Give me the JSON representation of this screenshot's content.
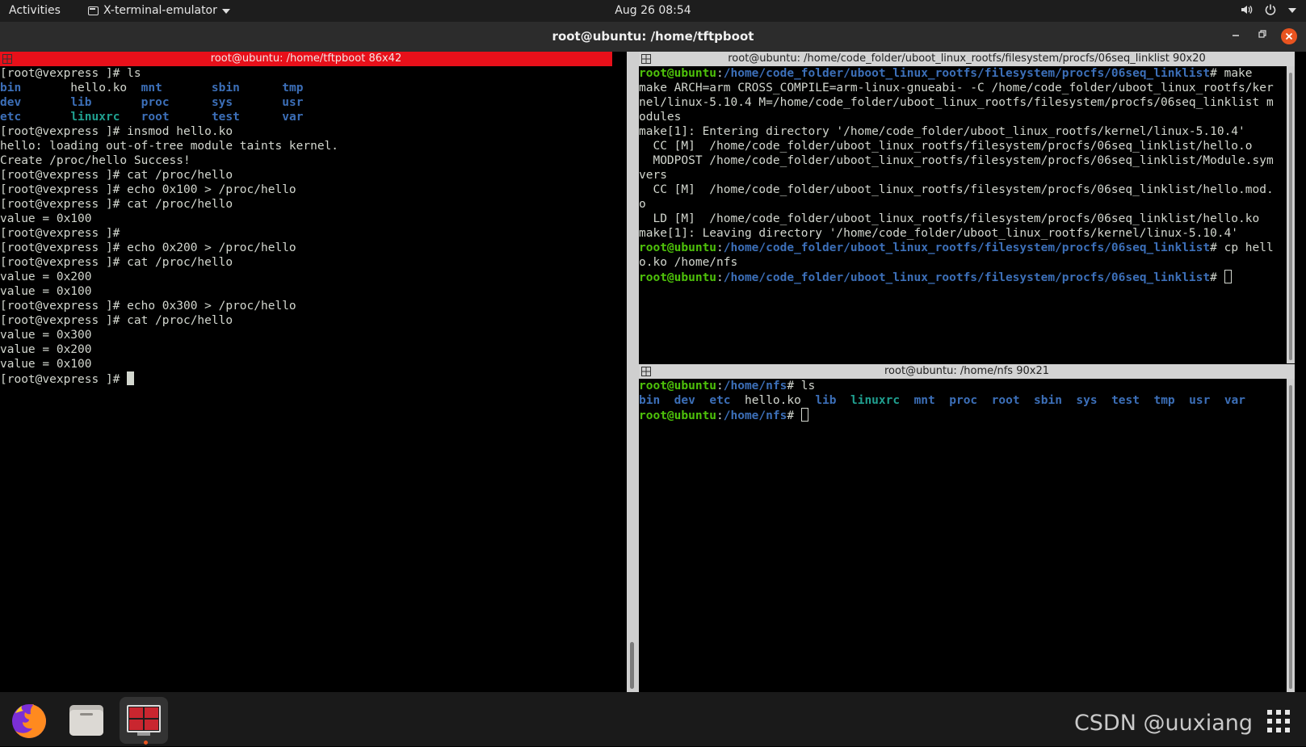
{
  "topbar": {
    "activities": "Activities",
    "app_name": "X-terminal-emulator",
    "clock": "Aug 26  08:54"
  },
  "window": {
    "title": "root@ubuntu: /home/tftpboot",
    "colors": {
      "close_button": "#e95420",
      "active_pane_title": "#e8101a"
    }
  },
  "panes": {
    "left": {
      "title": "root@ubuntu: /home/tftpboot 86x42",
      "lines": [
        [
          {
            "t": "[root@vexpress ]# ls"
          }
        ],
        [
          {
            "t": "bin",
            "c": "blue"
          },
          {
            "t": "       hello.ko  "
          },
          {
            "t": "mnt",
            "c": "blue"
          },
          {
            "t": "       "
          },
          {
            "t": "sbin",
            "c": "blue"
          },
          {
            "t": "      "
          },
          {
            "t": "tmp",
            "c": "blue"
          }
        ],
        [
          {
            "t": "dev",
            "c": "blue"
          },
          {
            "t": "       "
          },
          {
            "t": "lib",
            "c": "blue"
          },
          {
            "t": "       "
          },
          {
            "t": "proc",
            "c": "blue"
          },
          {
            "t": "      "
          },
          {
            "t": "sys",
            "c": "blue"
          },
          {
            "t": "       "
          },
          {
            "t": "usr",
            "c": "blue"
          }
        ],
        [
          {
            "t": "etc",
            "c": "blue"
          },
          {
            "t": "       "
          },
          {
            "t": "linuxrc",
            "c": "cyan"
          },
          {
            "t": "   "
          },
          {
            "t": "root",
            "c": "blue"
          },
          {
            "t": "      "
          },
          {
            "t": "test",
            "c": "blue"
          },
          {
            "t": "      "
          },
          {
            "t": "var",
            "c": "blue"
          }
        ],
        [
          {
            "t": "[root@vexpress ]# insmod hello.ko"
          }
        ],
        [
          {
            "t": "hello: loading out-of-tree module taints kernel."
          }
        ],
        [
          {
            "t": "Create /proc/hello Success!"
          }
        ],
        [
          {
            "t": "[root@vexpress ]# cat /proc/hello"
          }
        ],
        [
          {
            "t": "[root@vexpress ]# echo 0x100 > /proc/hello"
          }
        ],
        [
          {
            "t": "[root@vexpress ]# cat /proc/hello"
          }
        ],
        [
          {
            "t": "value = 0x100"
          }
        ],
        [
          {
            "t": "[root@vexpress ]#"
          }
        ],
        [
          {
            "t": "[root@vexpress ]# echo 0x200 > /proc/hello"
          }
        ],
        [
          {
            "t": "[root@vexpress ]# cat /proc/hello"
          }
        ],
        [
          {
            "t": "value = 0x200"
          }
        ],
        [
          {
            "t": "value = 0x100"
          }
        ],
        [
          {
            "t": "[root@vexpress ]# echo 0x300 > /proc/hello"
          }
        ],
        [
          {
            "t": "[root@vexpress ]# cat /proc/hello"
          }
        ],
        [
          {
            "t": "value = 0x300"
          }
        ],
        [
          {
            "t": "value = 0x200"
          }
        ],
        [
          {
            "t": "value = 0x100"
          }
        ],
        [
          {
            "t": "[root@vexpress ]# "
          },
          {
            "cursor": "block"
          }
        ]
      ]
    },
    "top_right": {
      "title": "root@ubuntu: /home/code_folder/uboot_linux_rootfs/filesystem/procfs/06seq_linklist 90x20",
      "lines": [
        [
          {
            "t": "root@ubuntu",
            "c": "green"
          },
          {
            "t": ":"
          },
          {
            "t": "/home/code_folder/uboot_linux_rootfs/filesystem/procfs/06seq_linklist",
            "c": "blue"
          },
          {
            "t": "# make"
          }
        ],
        [
          {
            "t": "make ARCH=arm CROSS_COMPILE=arm-linux-gnueabi- -C /home/code_folder/uboot_linux_rootfs/ker"
          }
        ],
        [
          {
            "t": "nel/linux-5.10.4 M=/home/code_folder/uboot_linux_rootfs/filesystem/procfs/06seq_linklist m"
          }
        ],
        [
          {
            "t": "odules"
          }
        ],
        [
          {
            "t": "make[1]: Entering directory '/home/code_folder/uboot_linux_rootfs/kernel/linux-5.10.4'"
          }
        ],
        [
          {
            "t": "  CC [M]  /home/code_folder/uboot_linux_rootfs/filesystem/procfs/06seq_linklist/hello.o"
          }
        ],
        [
          {
            "t": "  MODPOST /home/code_folder/uboot_linux_rootfs/filesystem/procfs/06seq_linklist/Module.sym"
          }
        ],
        [
          {
            "t": "vers"
          }
        ],
        [
          {
            "t": "  CC [M]  /home/code_folder/uboot_linux_rootfs/filesystem/procfs/06seq_linklist/hello.mod."
          }
        ],
        [
          {
            "t": "o"
          }
        ],
        [
          {
            "t": "  LD [M]  /home/code_folder/uboot_linux_rootfs/filesystem/procfs/06seq_linklist/hello.ko"
          }
        ],
        [
          {
            "t": "make[1]: Leaving directory '/home/code_folder/uboot_linux_rootfs/kernel/linux-5.10.4'"
          }
        ],
        [
          {
            "t": "root@ubuntu",
            "c": "green"
          },
          {
            "t": ":"
          },
          {
            "t": "/home/code_folder/uboot_linux_rootfs/filesystem/procfs/06seq_linklist",
            "c": "blue"
          },
          {
            "t": "# cp hell"
          }
        ],
        [
          {
            "t": "o.ko /home/nfs"
          }
        ],
        [
          {
            "t": "root@ubuntu",
            "c": "green"
          },
          {
            "t": ":"
          },
          {
            "t": "/home/code_folder/uboot_linux_rootfs/filesystem/procfs/06seq_linklist",
            "c": "blue"
          },
          {
            "t": "# "
          },
          {
            "cursor": "hollow"
          }
        ]
      ]
    },
    "bottom_right": {
      "title": "root@ubuntu: /home/nfs 90x21",
      "lines": [
        [
          {
            "t": "root@ubuntu",
            "c": "green"
          },
          {
            "t": ":"
          },
          {
            "t": "/home/nfs",
            "c": "blue"
          },
          {
            "t": "# ls"
          }
        ],
        [
          {
            "t": "bin",
            "c": "blue"
          },
          {
            "t": "  "
          },
          {
            "t": "dev",
            "c": "blue"
          },
          {
            "t": "  "
          },
          {
            "t": "etc",
            "c": "blue"
          },
          {
            "t": "  hello.ko  "
          },
          {
            "t": "lib",
            "c": "blue"
          },
          {
            "t": "  "
          },
          {
            "t": "linuxrc",
            "c": "cyan"
          },
          {
            "t": "  "
          },
          {
            "t": "mnt",
            "c": "blue"
          },
          {
            "t": "  "
          },
          {
            "t": "proc",
            "c": "blue"
          },
          {
            "t": "  "
          },
          {
            "t": "root",
            "c": "blue"
          },
          {
            "t": "  "
          },
          {
            "t": "sbin",
            "c": "blue"
          },
          {
            "t": "  "
          },
          {
            "t": "sys",
            "c": "blue"
          },
          {
            "t": "  "
          },
          {
            "t": "test",
            "c": "blue"
          },
          {
            "t": "  "
          },
          {
            "t": "tmp",
            "c": "blue"
          },
          {
            "t": "  "
          },
          {
            "t": "usr",
            "c": "blue"
          },
          {
            "t": "  "
          },
          {
            "t": "var",
            "c": "blue"
          }
        ],
        [
          {
            "t": "root@ubuntu",
            "c": "green"
          },
          {
            "t": ":"
          },
          {
            "t": "/home/nfs",
            "c": "blue"
          },
          {
            "t": "# "
          },
          {
            "cursor": "hollow"
          }
        ]
      ]
    }
  },
  "dock": {
    "items": [
      {
        "name": "firefox-icon"
      },
      {
        "name": "files-icon"
      },
      {
        "name": "terminal-icon"
      }
    ],
    "show_apps": "grid-icon"
  },
  "watermark": "CSDN @uuxiang"
}
